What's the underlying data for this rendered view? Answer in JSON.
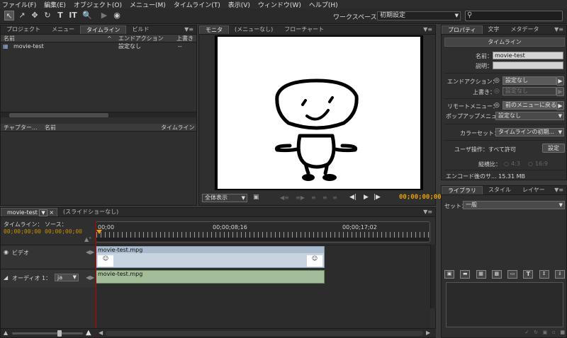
{
  "menubar": [
    "ファイル(F)",
    "編集(E)",
    "オブジェクト(O)",
    "メニュー(M)",
    "タイムライン(T)",
    "表示(V)",
    "ウィンドウ(W)",
    "ヘルプ(H)"
  ],
  "toolbar": {
    "workspace_label": "ワークスペース：",
    "workspace_value": "初期設定",
    "search_placeholder": ""
  },
  "project_panel": {
    "tabs": [
      "プロジェクト",
      "メニュー",
      "タイムライン",
      "ビルド"
    ],
    "columns": [
      "名前",
      "エンドアクション",
      "上書き"
    ],
    "rows": [
      {
        "name": "movie-test",
        "end_action": "設定なし",
        "override": "--"
      }
    ],
    "chapter_columns": [
      "チャプター...",
      "名前",
      "タイムライン"
    ]
  },
  "monitor_panel": {
    "tabs": [
      "モニタ",
      "(メニューなし)",
      "フローチャート"
    ],
    "zoom_select": "全体表示",
    "timecode": "00;00;00;00"
  },
  "properties_panel": {
    "tabs": [
      "プロパティ",
      "文字",
      "メタデータ"
    ],
    "title": "タイムライン",
    "name_label": "名前：",
    "name_value": "movie-test",
    "desc_label": "説明：",
    "desc_value": "",
    "end_action_label": "エンドアクション：",
    "end_action_value": "設定なし",
    "override_label": "上書き：",
    "override_value": "設定なし",
    "remote_menu_label": "リモートメニュー：",
    "remote_menu_value": "前のメニューに戻る",
    "popup_menu_label": "ポップアップメニュ...",
    "popup_menu_value": "設定なし",
    "color_set_label": "カラーセット：",
    "color_set_value": "タイムラインの初期...",
    "user_op_label": "ユーザ操作：すべて許可",
    "user_op_button": "設定",
    "aspect_label": "縦横比：",
    "aspect_43": "4:3",
    "aspect_169": "16:9",
    "encoded_size": "エンコード後のサ... 15.31 MB"
  },
  "library_panel": {
    "tabs": [
      "ライブラリ",
      "スタイル",
      "レイヤー"
    ],
    "set_label": "セット：",
    "set_value": "一般"
  },
  "timeline_panel": {
    "tabs": [
      "movie-test",
      "(スライドショーなし)"
    ],
    "timeline_label": "タイムライン：",
    "source_label": "ソース：",
    "timeline_tc": "00;00;00;00",
    "source_tc": "00;00;00;00",
    "ruler_marks": [
      "00;00",
      "00;00;08;16",
      "00;00;17;02"
    ],
    "video_track_label": "ビデオ",
    "video_clip": "movie-test.mpg",
    "audio_track_label": "オーディオ 1：",
    "audio_lang": "ja",
    "audio_clip": "movie-test.mpg"
  },
  "colors": {
    "panel_bg": "#2f2f2f",
    "video_clip": "#b7c7d8",
    "audio_clip": "#9bb592",
    "timecode": "#e8a200",
    "playhead": "#c80000"
  }
}
